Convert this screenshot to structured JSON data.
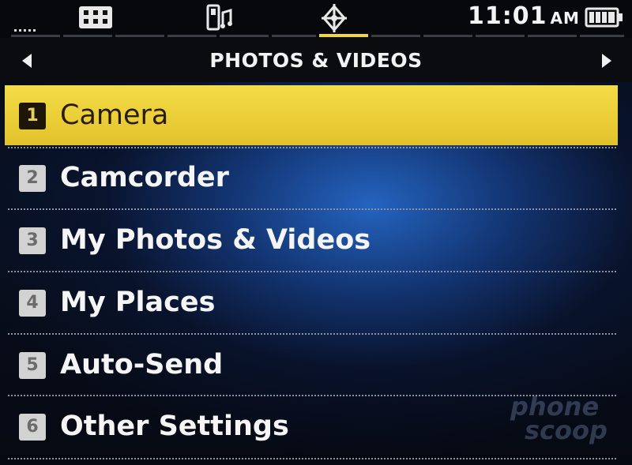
{
  "status_bar": {
    "time": "11:01",
    "ampm": "AM",
    "icons": [
      "signal-icon",
      "network-icon",
      "music-phone-icon",
      "location-icon",
      "battery-icon"
    ]
  },
  "header": {
    "title": "PHOTOS & VIDEOS",
    "left_arrow": "left-arrow-icon",
    "right_arrow": "right-arrow-icon"
  },
  "menu": {
    "items": [
      {
        "number": "1",
        "label": "Camera",
        "selected": true
      },
      {
        "number": "2",
        "label": "Camcorder",
        "selected": false
      },
      {
        "number": "3",
        "label": "My Photos & Videos",
        "selected": false
      },
      {
        "number": "4",
        "label": "My Places",
        "selected": false
      },
      {
        "number": "5",
        "label": "Auto-Send",
        "selected": false
      },
      {
        "number": "6",
        "label": "Other Settings",
        "selected": false
      }
    ]
  },
  "watermark": {
    "line1": "phone",
    "line2": "scoop"
  },
  "colors": {
    "highlight": "#f0d640",
    "status_active": "#f2d63a",
    "background_glow": "#2668c8",
    "text": "#f5f5f5"
  }
}
